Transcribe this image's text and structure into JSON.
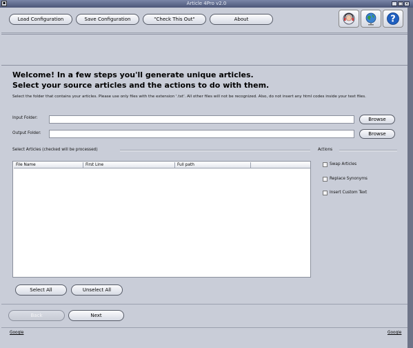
{
  "window": {
    "title": "Article 4Pro v2.0",
    "controls": [
      "_",
      "□",
      "×"
    ]
  },
  "toolbar": {
    "load_label": "Load Configuration",
    "save_label": "Save Configuration",
    "check_label": "\"Check This Out\"",
    "about_label": "About"
  },
  "welcome": {
    "line1": "Welcome! In a few steps you'll generate unique articles.",
    "line2": "Select your source articles and the actions to do with them.",
    "note": "Select the folder that contains your articles. Please use only files with the extension '.txt'. All other files will not be recognized. Also, do not insert any html codes inside your text files."
  },
  "input_folder": {
    "label": "Input Folder:",
    "value": "",
    "browse_label": "Browse"
  },
  "output_folder": {
    "label": "Output Folder:",
    "value": "",
    "browse_label": "Browse"
  },
  "articles": {
    "section_label": "Select Articles (checked will be processed)",
    "columns": [
      "File Name",
      "First Line",
      "Full path",
      ""
    ],
    "rows": [],
    "select_all_label": "Select All",
    "unselect_all_label": "Unselect All"
  },
  "actions": {
    "section_label": "Actions",
    "items": [
      {
        "label": "Swap Articles",
        "checked": false
      },
      {
        "label": "Replace Synonyms",
        "checked": false
      },
      {
        "label": "Insert Custom Text",
        "checked": false
      }
    ]
  },
  "navigation": {
    "back_label": "Back",
    "next_label": "Next"
  },
  "status": {
    "left_link": "Google",
    "right_link": "Google"
  },
  "colors": {
    "background": "#c9cdd8",
    "titlebar": "#5a6688",
    "accent": "#1f5fbf"
  }
}
